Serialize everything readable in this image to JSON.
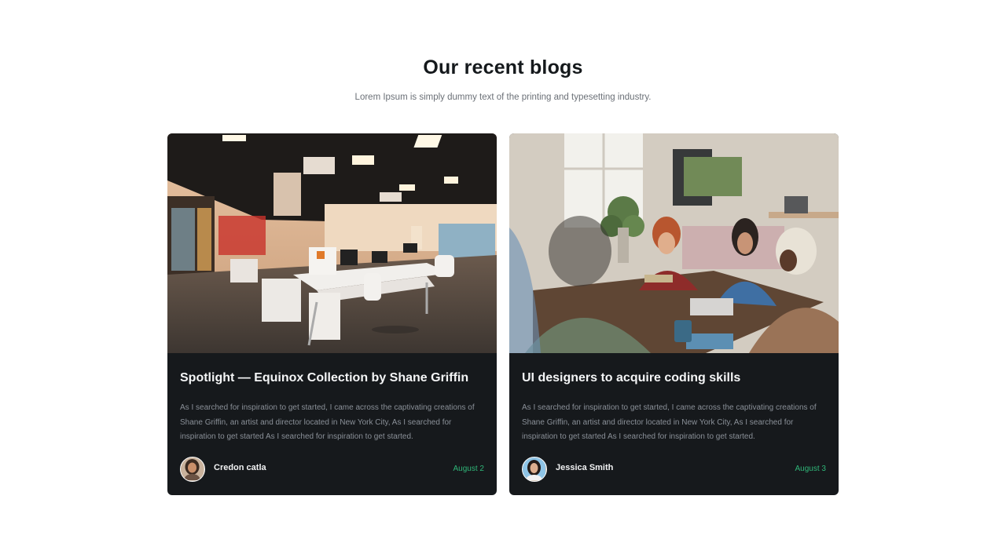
{
  "section": {
    "title": "Our recent blogs",
    "subtitle": "Lorem Ipsum is simply dummy text of the printing and typesetting industry."
  },
  "posts": [
    {
      "title": "Spotlight — Equinox Collection by Shane Griffin",
      "excerpt": "As I searched for inspiration to get started, I came across the captivating creations of Shane Griffin, an artist and director located in New York City, As I searched for inspiration to get started As I searched for inspiration to get started.",
      "author": "Credon catla",
      "date": "August 2",
      "image": "open-plan-office-photo"
    },
    {
      "title": "UI designers to acquire coding skills",
      "excerpt": "As I searched for inspiration to get started, I came across the captivating creations of Shane Griffin, an artist and director located in New York City, As I searched for inspiration to get started As I searched for inspiration to get started.",
      "author": "Jessica Smith",
      "date": "August 3",
      "image": "team-meeting-photo"
    }
  ],
  "colors": {
    "card_background": "#16191c",
    "date_accent": "#2fb678",
    "heading": "#15191c"
  }
}
